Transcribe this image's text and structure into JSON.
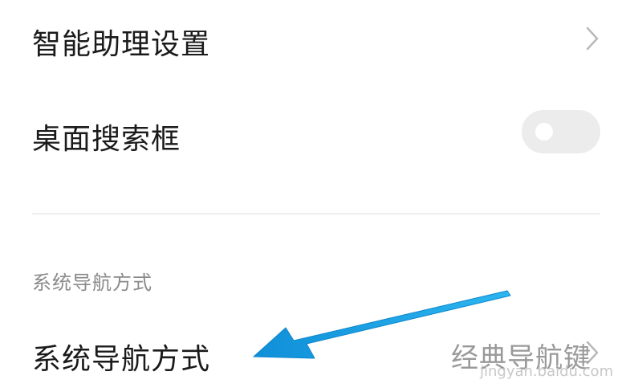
{
  "settings": {
    "assistant_settings": {
      "label": "智能助理设置",
      "icon": "chevron-right-icon"
    },
    "desktop_search_box": {
      "label": "桌面搜索框",
      "toggle_state": "off"
    },
    "section_header": "系统导航方式",
    "navigation_mode": {
      "label": "系统导航方式",
      "value": "经典导航键",
      "icon": "chevron-right-icon"
    }
  },
  "overlay": {
    "watermark": "jingyan.baidu.com",
    "arrow_color": "#1aa3e8"
  }
}
